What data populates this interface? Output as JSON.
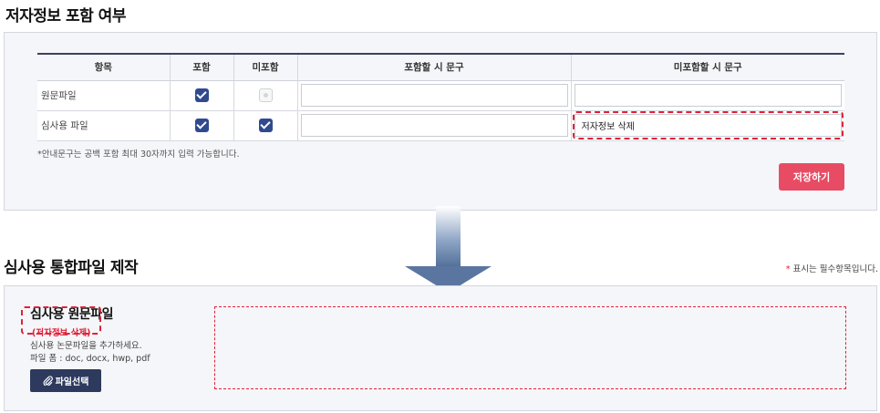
{
  "section1": {
    "title": "저자정보 포함 여부",
    "table": {
      "headers": [
        "항목",
        "포함",
        "미포함",
        "포함할 시 문구",
        "미포함할 시 문구"
      ],
      "rows": [
        {
          "item": "원문파일",
          "include_checked": true,
          "exclude_checked": false,
          "include_text": "",
          "exclude_text": ""
        },
        {
          "item": "심사용 파일",
          "include_checked": true,
          "exclude_checked": true,
          "include_text": "",
          "exclude_text": "저자정보 삭제"
        }
      ]
    },
    "note": "*안내문구는 공백 포함 최대 30자까지 입력 가능합니다.",
    "save_label": "저장하기"
  },
  "section2": {
    "title": "심사용 통합파일 제작",
    "required_star": "*",
    "required_text": " 표시는 필수항목입니다.",
    "file_title": "심사용 원문파일",
    "file_subtitle": "(저자정보 삭제)",
    "file_desc": "심사용 논문파일을 추가하세요.",
    "file_formats": "파일 폼 : doc, docx, hwp, pdf",
    "file_button_label": "파일선택"
  },
  "colors": {
    "accent_red": "#e74c64",
    "dashed_red": "#e0223a",
    "navy": "#2d3a5d",
    "checkbox_blue": "#2f4a8f"
  }
}
